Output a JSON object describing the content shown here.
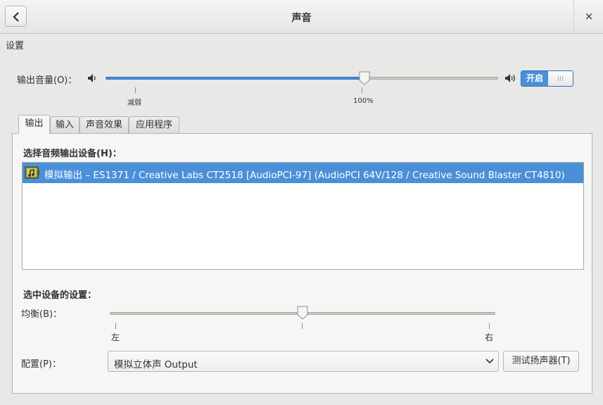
{
  "window": {
    "title": "声音",
    "close_glyph": "×"
  },
  "settings_label": "设置",
  "output_volume": {
    "label": "输出音量(O)：",
    "level_percent": 66,
    "tick_low": "减弱",
    "tick_100": "100%",
    "switch_label": "开启",
    "switch_on": true
  },
  "tabs": [
    {
      "label": "输出",
      "active": true
    },
    {
      "label": "输入",
      "active": false
    },
    {
      "label": "声音效果",
      "active": false
    },
    {
      "label": "应用程序",
      "active": false
    }
  ],
  "output_tab": {
    "device_section_title": "选择音频输出设备(H)：",
    "devices": [
      {
        "name": "模拟输出",
        "description": "–  ES1371 / Creative Labs CT2518 [AudioPCI-97] (AudioPCI 64V/128 / Creative Sound Blaster CT4810)",
        "selected": true
      }
    ],
    "selected_settings_title": "选中设备的设置：",
    "balance": {
      "label": "均衡(B)：",
      "value": 0,
      "left_label": "左",
      "right_label": "右"
    },
    "profile": {
      "label": "配置(P)：",
      "selected": "模拟立体声  Output"
    },
    "test_button": "测试扬声器(T)"
  },
  "colors": {
    "accent": "#4a90d9",
    "background": "#e8e8e7",
    "panel": "#f6f6f5"
  }
}
